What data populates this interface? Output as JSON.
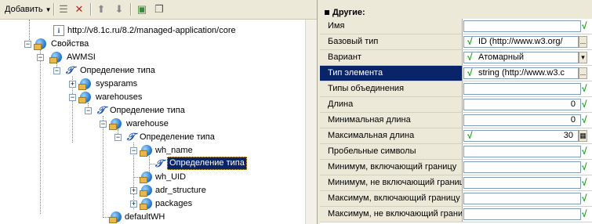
{
  "toolbar": {
    "add_label": "Добавить",
    "icons": [
      "add-child-icon",
      "delete-icon",
      "move-up-icon",
      "move-down-icon",
      "refresh-icon",
      "copy-icon"
    ]
  },
  "tree": {
    "items": [
      {
        "label": "http://v8.1c.ru/8.2/managed-application/core",
        "icon": "info-icon"
      },
      {
        "label": "Свойства",
        "icon": "folder-icon",
        "expander": "−"
      },
      {
        "label": "AWMSI",
        "icon": "folder-icon",
        "expander": "−"
      },
      {
        "label": "Определение типа",
        "icon": "type-icon",
        "expander": "−"
      },
      {
        "label": "sysparams",
        "icon": "folder-icon",
        "expander": "+"
      },
      {
        "label": "warehouses",
        "icon": "folder-icon",
        "expander": "−"
      },
      {
        "label": "Определение типа",
        "icon": "type-icon",
        "expander": "−"
      },
      {
        "label": "warehouse",
        "icon": "folder-icon",
        "expander": "−"
      },
      {
        "label": "Определение типа",
        "icon": "type-icon",
        "expander": "−"
      },
      {
        "label": "wh_name",
        "icon": "folder-icon",
        "expander": "−"
      },
      {
        "label": "Определение типа",
        "icon": "type-icon",
        "selected": true
      },
      {
        "label": "wh_UID",
        "icon": "folder-icon"
      },
      {
        "label": "adr_structure",
        "icon": "folder-icon",
        "expander": "+"
      },
      {
        "label": "packages",
        "icon": "folder-icon",
        "expander": "+"
      },
      {
        "label": "defaultWH",
        "icon": "folder-icon"
      }
    ]
  },
  "properties": {
    "section_title": "Другие:",
    "rows": [
      {
        "name": "Имя",
        "value": ""
      },
      {
        "name": "Базовый тип",
        "value": "ID (http://www.w3.org/",
        "checked": true,
        "button": "..."
      },
      {
        "name": "Вариант",
        "value": "Атомарный",
        "checked": true,
        "button": "▾"
      },
      {
        "name": "Тип элемента",
        "value": "string (http://www.w3.c",
        "checked": true,
        "button": "...",
        "active": true
      },
      {
        "name": "Типы объединения",
        "value": ""
      },
      {
        "name": "Длина",
        "value": "0"
      },
      {
        "name": "Минимальная длина",
        "value": "0"
      },
      {
        "name": "Максимальная длина",
        "value": "30",
        "checked": true,
        "button": "▦"
      },
      {
        "name": "Пробельные символы",
        "value": ""
      },
      {
        "name": "Минимум, включающий границу",
        "value": ""
      },
      {
        "name": "Минимум, не включающий границу",
        "value": ""
      },
      {
        "name": "Максимум, включающий границу",
        "value": ""
      },
      {
        "name": "Максимум, не включающий границу",
        "value": ""
      }
    ],
    "right_check": "√"
  }
}
